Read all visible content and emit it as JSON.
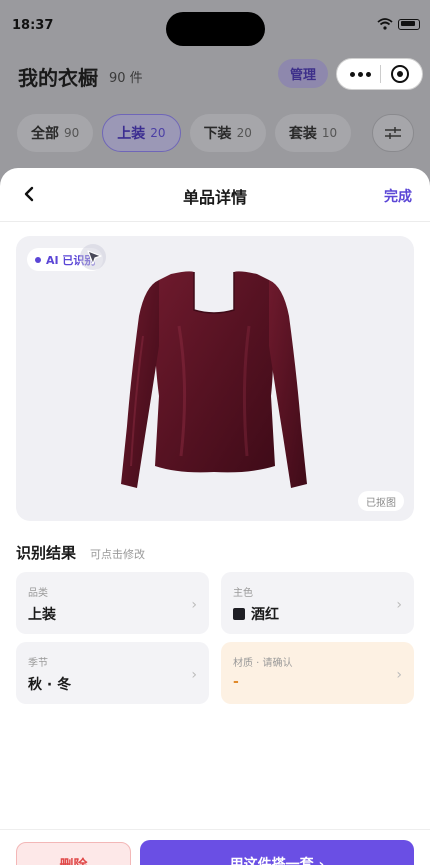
{
  "status_bar": {
    "time": "18:37"
  },
  "background_page": {
    "title": "我的衣橱",
    "count": "90 件",
    "manage_label": "管理",
    "filters": [
      {
        "label": "全部",
        "count": "90",
        "active": false
      },
      {
        "label": "上装",
        "count": "20",
        "active": true
      },
      {
        "label": "下装",
        "count": "20",
        "active": false
      },
      {
        "label": "套装",
        "count": "10",
        "active": false
      }
    ]
  },
  "sheet": {
    "title": "单品详情",
    "done_label": "完成",
    "ai_badge": "AI 已识别",
    "cutout_tag": "已抠图",
    "section_title": "识别结果",
    "section_hint": "可点击修改",
    "fields": {
      "category": {
        "label": "品类",
        "value": "上装"
      },
      "color": {
        "label": "主色",
        "value": "酒红",
        "swatch": "#1e1e24"
      },
      "season": {
        "label": "季节",
        "value": "秋 · 冬"
      },
      "material": {
        "label": "材质 · 请确认",
        "value": "-"
      }
    },
    "delete_label": "删除",
    "primary_label": "用这件搭一套 ›"
  },
  "colors": {
    "accent": "#5b46d6",
    "garment": "#5a1424",
    "warn_bg": "#fdf1e3"
  },
  "icons": [
    "wifi-icon",
    "battery-icon",
    "more-icon",
    "target-icon",
    "filter-icon",
    "back-icon",
    "cursor-icon",
    "chevron-right-icon"
  ]
}
